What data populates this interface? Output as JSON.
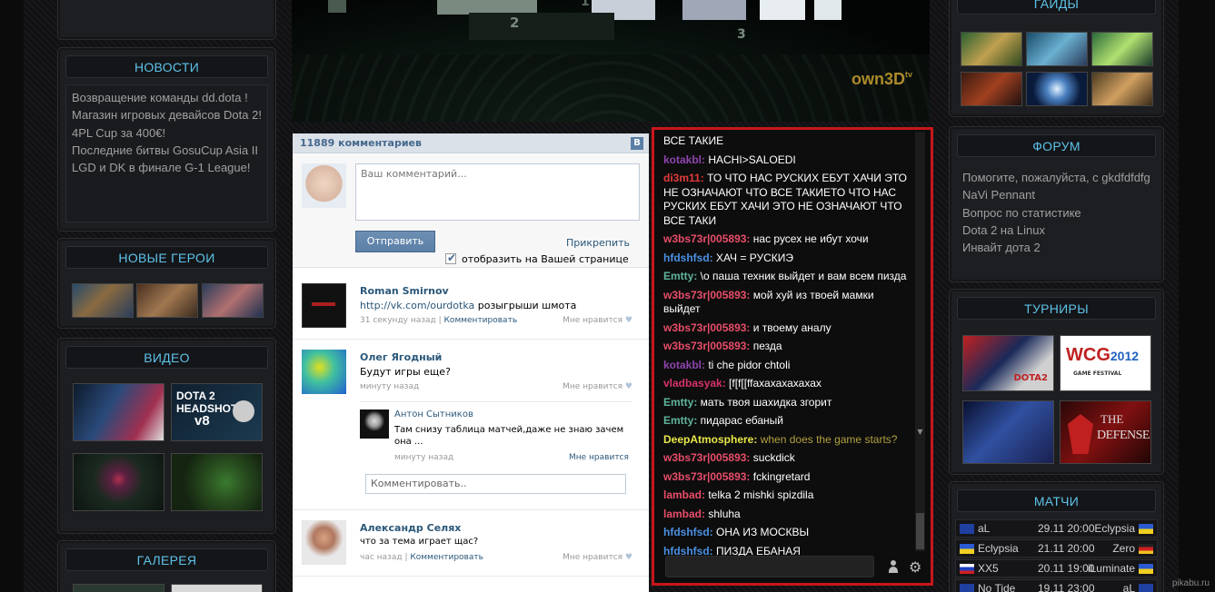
{
  "left": {
    "news": {
      "title": "НОВОСТИ",
      "items": [
        "Возвращение команды dd.dota !",
        "Магазин игровых девайсов Dota 2!",
        "4PL Cup за 400€!",
        "Последние битвы GosuCup Asia II",
        "LGD и DK в финале G-1 League!"
      ]
    },
    "heroes": {
      "title": "НОВЫЕ ГЕРОИ"
    },
    "video": {
      "title": "ВИДЕО",
      "thumb2_line1": "DOTA 2",
      "thumb2_line2": "HEADSHOT",
      "thumb2_line3": "v8"
    },
    "gallery": {
      "title": "ГАЛЕРЕЯ"
    }
  },
  "stream": {
    "watermark": "own3D",
    "watermark_tv": "tv",
    "stage_num_2": "2",
    "stage_num_3": "3",
    "stage_num_1": "1",
    "banner_year": "2012"
  },
  "vk": {
    "comments_count": "11889 комментариев",
    "vk_logo": "B",
    "textarea_placeholder": "Ваш комментарий...",
    "send_button": "Отправить",
    "attach_link": "Прикрепить",
    "show_on_page": "отобразить на Вашей странице",
    "posts": [
      {
        "author": "Roman Smirnov",
        "link": "http://vk.com/ourdotka",
        "text": " розыгрыши шмота",
        "time": "31 секунду назад",
        "comment_link": "Комментировать",
        "like": "Мне нравится"
      },
      {
        "author": "Олег Ягодный",
        "text": "Будут игры еще?",
        "time": "минуту назад",
        "like": "Мне нравится"
      },
      {
        "author": "Александр Селях",
        "text": "что за тема играет щас?",
        "time": "час назад",
        "comment_link": "Комментировать",
        "like": "Мне нравится"
      }
    ],
    "reply": {
      "author": "Антон Сытников",
      "text": "Там снизу таблица матчей,даже не знаю зачем она ...",
      "time": "минуту назад",
      "like": "Мне нравится"
    },
    "comment_input_placeholder": "Комментировать.."
  },
  "chat": {
    "messages": [
      {
        "user": "",
        "text": "ВСЕ ТАКИЕ",
        "color": "#ffffff"
      },
      {
        "user": "kotakbl:",
        "text": " HACHI>SALOEDI",
        "color": "#8e44ad"
      },
      {
        "user": "di3m11:",
        "text": " ТО ЧТО НАС РУСКИХ ЕБУТ ХАЧИ ЭТО НЕ ОЗНАЧАЮТ ЧТО ВСЕ ТАКИЕТО ЧТО НАС РУСКИХ ЕБУТ ХАЧИ ЭТО НЕ ОЗНАЧАЮТ ЧТО ВСЕ ТАКИ",
        "color": "#e33b3b"
      },
      {
        "user": "w3bs73r|005893:",
        "text": " нас русех не ибут хочи",
        "color": "#e84d6a"
      },
      {
        "user": "hfdshfsd:",
        "text": " ХАЧ = РУСКИЭ",
        "color": "#4a90e2"
      },
      {
        "user": "Emtty:",
        "text": " \\o  паша техник выйдет и вам всем пизда",
        "color": "#5fb49c"
      },
      {
        "user": "w3bs73r|005893:",
        "text": " мой хуй из твоей мамки выйдет",
        "color": "#e84d6a"
      },
      {
        "user": "w3bs73r|005893:",
        "text": " и твоему аналу",
        "color": "#e84d6a"
      },
      {
        "user": "w3bs73r|005893:",
        "text": " пезда",
        "color": "#e84d6a"
      },
      {
        "user": "kotakbl:",
        "text": " ti che pidor chtoli",
        "color": "#8e44ad"
      },
      {
        "user": "vladbasyak:",
        "text": " [f[f[[ffахахахахахах",
        "color": "#d7336b"
      },
      {
        "user": "Emtty:",
        "text": " мать твоя шахидка згорит",
        "color": "#5fb49c"
      },
      {
        "user": "Emtty:",
        "text": " пидарас ебаный",
        "color": "#5fb49c"
      },
      {
        "user": "DeepAtmosphere:",
        "text": " when does the game starts?",
        "color": "#e7e74b",
        "text_color": "#b0a040"
      },
      {
        "user": "w3bs73r|005893:",
        "text": " suckdick",
        "color": "#e84d6a"
      },
      {
        "user": "w3bs73r|005893:",
        "text": " fckingretard",
        "color": "#e84d6a"
      },
      {
        "user": "lambad:",
        "text": " telka 2 mishki spizdila",
        "color": "#e84d6a"
      },
      {
        "user": "lambad:",
        "text": " shluha",
        "color": "#e84d6a"
      },
      {
        "user": "hfdshfsd:",
        "text": " ОНА ИЗ МОСКВЫ",
        "color": "#4a90e2"
      },
      {
        "user": "hfdshfsd:",
        "text": " ПИЗДА ЕБАНАЯ",
        "color": "#4a90e2"
      }
    ]
  },
  "right": {
    "guides": {
      "title": "ГАЙДЫ"
    },
    "forum": {
      "title": "ФОРУМ",
      "items": [
        "Помогите, пожалуйста, с gkdfdfdfg",
        "NaVi Pennant",
        "Вопрос по статистике",
        "Dota 2 на Linux",
        "Инвайт дота 2"
      ]
    },
    "tournaments": {
      "title": "ТУРНИРЫ",
      "wcg_text": "WCG",
      "wcg_year": "2012",
      "wcg_sub": "GAME FESTIVAL",
      "defense_the": "THE",
      "defense_word": "DEFENSE",
      "dota2": "DOTA2"
    },
    "matches": {
      "title": "МАТЧИ",
      "rows": [
        {
          "team1": "aL",
          "date": "29.11 20:00",
          "team2": "Eclypsia"
        },
        {
          "team1": "Eclypsia",
          "date": "21.11 20:00",
          "team2": "Zero"
        },
        {
          "team1": "XX5",
          "date": "20.11 19:00",
          "team2": "iLuminate"
        },
        {
          "team1": "No Tide",
          "date": "19.11 23:00",
          "team2": "aL"
        }
      ]
    }
  },
  "watermark": "pikabu.ru"
}
